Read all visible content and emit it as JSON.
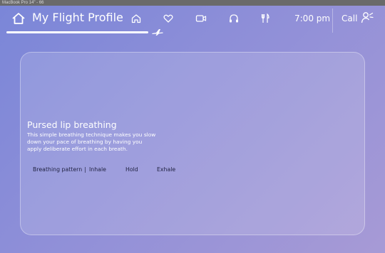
{
  "device_label": "MacBook Pro 14\" - 66",
  "header": {
    "title": "My Flight Profile",
    "icons": [
      "home-icon",
      "heart-icon",
      "video-icon",
      "headphones-icon",
      "dining-icon"
    ],
    "time": "7:00 pm",
    "call_label": "Call"
  },
  "flight_progress": 0.84,
  "card": {
    "title": "Pursed lip breathing",
    "description": "This simple breathing technique makes you slow down your pace of breathing by having you apply deliberate effort in each breath.",
    "pattern": {
      "label": "Breathing pattern",
      "separator": "|",
      "steps": [
        "Inhale",
        "Hold",
        "Exhale"
      ]
    }
  },
  "colors": {
    "bg_start": "#7a86d8",
    "bg_end": "#a79ad6",
    "text_dark": "#1f2140"
  }
}
